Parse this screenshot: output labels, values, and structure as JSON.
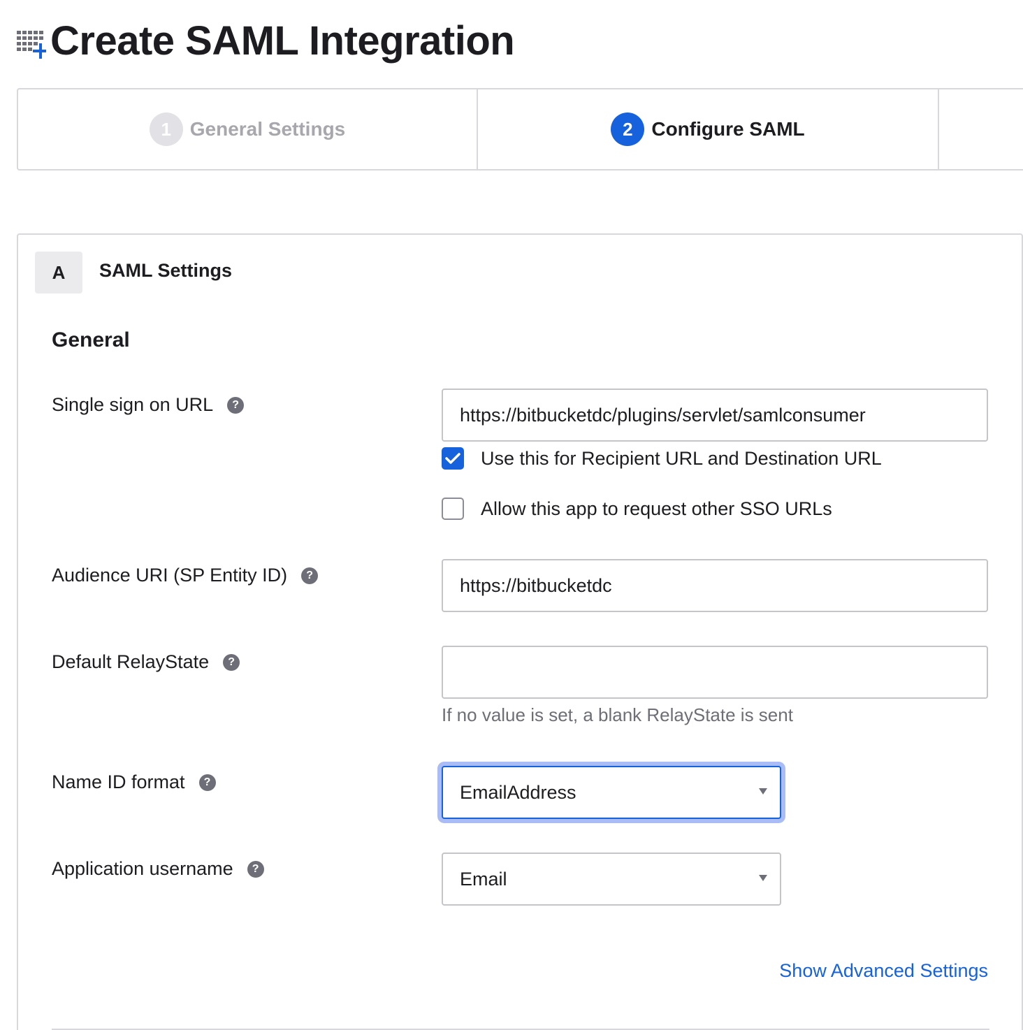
{
  "page": {
    "title": "Create SAML Integration",
    "title_icon": "app-add-icon"
  },
  "wizard": {
    "steps": [
      {
        "number": "1",
        "label": "General Settings",
        "state": "completed"
      },
      {
        "number": "2",
        "label": "Configure SAML",
        "state": "active"
      }
    ]
  },
  "section": {
    "badge": "A",
    "title": "SAML Settings",
    "subsection": "General"
  },
  "fields": {
    "sso_url": {
      "label": "Single sign on URL",
      "value": "https://bitbucketdc/plugins/servlet/samlconsumer",
      "use_recipient_label": "Use this for Recipient URL and Destination URL",
      "use_recipient_checked": true,
      "allow_other_label": "Allow this app to request other SSO URLs",
      "allow_other_checked": false
    },
    "audience_uri": {
      "label": "Audience URI (SP Entity ID)",
      "value": "https://bitbucketdc"
    },
    "relay_state": {
      "label": "Default RelayState",
      "value": "",
      "hint": "If no value is set, a blank RelayState is sent"
    },
    "name_id_format": {
      "label": "Name ID format",
      "selected": "EmailAddress"
    },
    "app_username": {
      "label": "Application username",
      "selected": "Email"
    }
  },
  "help_icon_glyph": "?",
  "links": {
    "advanced": "Show Advanced Settings"
  },
  "colors": {
    "accent": "#1662dd",
    "focus_ring": "#a9bcf5",
    "muted_text": "#6e6e78",
    "border": "#d7d7dc"
  }
}
